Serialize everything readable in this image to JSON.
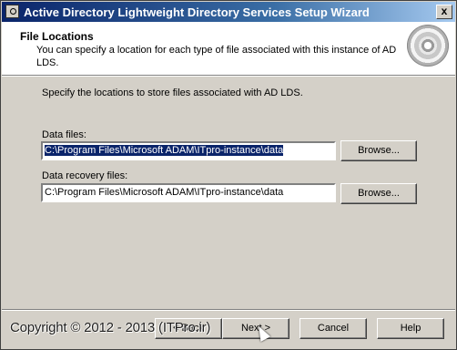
{
  "window": {
    "title": "Active Directory Lightweight Directory Services Setup Wizard",
    "close_glyph": "x"
  },
  "header": {
    "title": "File Locations",
    "description": "You can specify a location for each type of file associated with this instance of AD LDS.",
    "icon": "cd-disc-icon"
  },
  "main": {
    "instruction": "Specify the locations to store files associated with AD LDS.",
    "data_files": {
      "label": "Data files:",
      "value": "C:\\Program Files\\Microsoft ADAM\\ITpro-instance\\data",
      "browse_label": "Browse..."
    },
    "data_recovery_files": {
      "label": "Data recovery files:",
      "value": "C:\\Program Files\\Microsoft ADAM\\ITpro-instance\\data",
      "browse_label": "Browse..."
    }
  },
  "footer": {
    "back_label": "< Back",
    "next_label": "Next >",
    "cancel_label": "Cancel",
    "help_label": "Help"
  },
  "watermark": {
    "text": "Copyright © 2012 - 2013 (ITPro.ir)"
  }
}
